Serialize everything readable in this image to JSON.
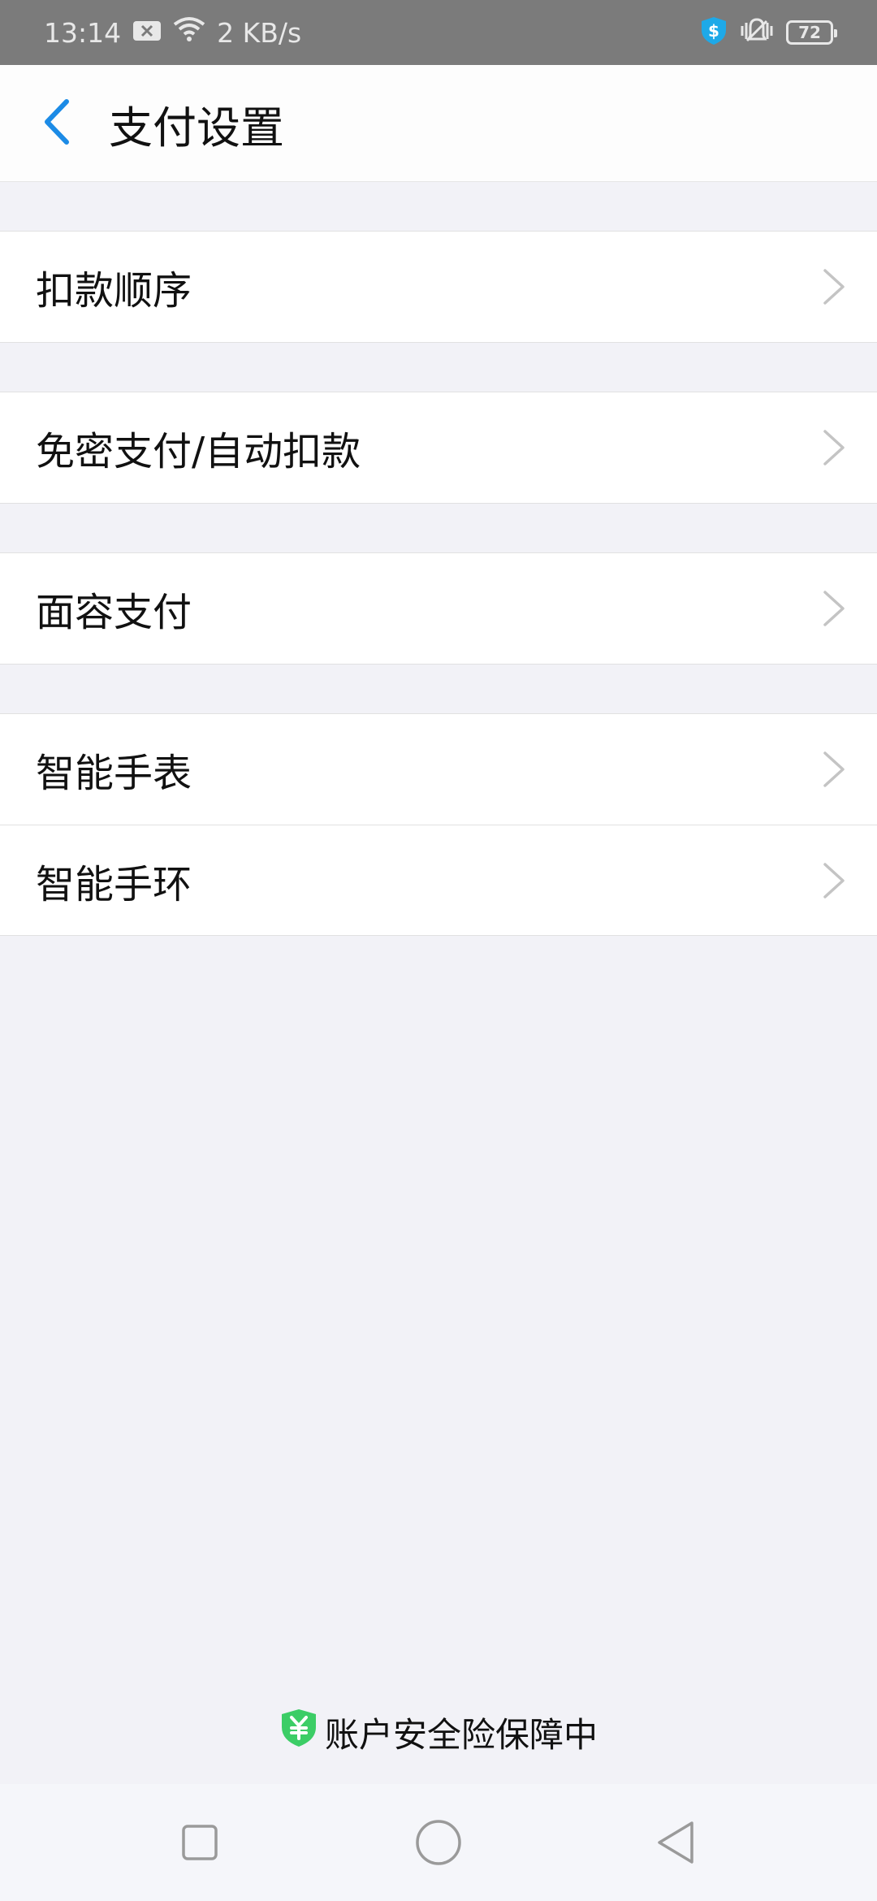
{
  "status_bar": {
    "time": "13:14",
    "net_speed": "2 KB/s",
    "battery": "72",
    "icons": [
      "notification-off-icon",
      "wifi-icon",
      "shield-dollar-icon",
      "vibrate-icon",
      "battery-icon"
    ]
  },
  "header": {
    "title": "支付设置",
    "back_icon": "chevron-left-icon"
  },
  "groups": [
    {
      "items": [
        {
          "label": "扣款顺序"
        }
      ]
    },
    {
      "items": [
        {
          "label": "免密支付/自动扣款"
        }
      ]
    },
    {
      "items": [
        {
          "label": "面容支付"
        }
      ]
    },
    {
      "items": [
        {
          "label": "智能手表"
        },
        {
          "label": "智能手环"
        }
      ]
    }
  ],
  "footer": {
    "text": "账户安全险保障中",
    "icon": "yuan-shield-icon",
    "icon_color": "#3ccd66"
  },
  "nav_bar": {
    "buttons": [
      "recent-apps-button",
      "home-button",
      "back-button"
    ]
  },
  "colors": {
    "accent": "#1c8be6",
    "status_bar_bg": "#7b7b7b",
    "page_bg": "#f2f2f7"
  }
}
